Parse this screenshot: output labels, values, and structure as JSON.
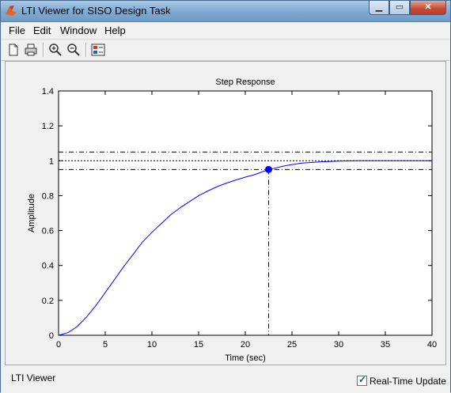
{
  "window": {
    "title": "LTI Viewer for SISO Design Task",
    "minimize": "▁",
    "maximize": "▭",
    "close": "✕"
  },
  "menu": [
    {
      "label": "File"
    },
    {
      "label": "Edit"
    },
    {
      "label": "Window"
    },
    {
      "label": "Help"
    }
  ],
  "toolbar": {
    "icons": [
      "new-document-icon",
      "print-icon",
      "zoom-in-icon",
      "zoom-out-icon",
      "plot-configuration-icon"
    ]
  },
  "status": {
    "label": "LTI Viewer"
  },
  "realtime": {
    "label": "Real-Time Update",
    "checked": true
  },
  "chart_data": {
    "type": "line",
    "title": "Step Response",
    "xlabel": "Time (sec)",
    "ylabel": "Amplitude",
    "xlim": [
      0,
      40
    ],
    "ylim": [
      0,
      1.4
    ],
    "xticks": [
      "0",
      "5",
      "10",
      "15",
      "20",
      "25",
      "30",
      "35",
      "40"
    ],
    "yticks": [
      "0",
      "0.2",
      "0.4",
      "0.6",
      "0.8",
      "1",
      "1.2",
      "1.4"
    ],
    "series": [
      {
        "x": [
          0,
          1,
          2,
          3,
          4,
          5,
          6,
          7,
          8,
          9,
          10,
          11,
          12,
          13,
          14,
          15,
          16,
          17,
          18,
          19,
          20,
          21,
          22,
          23,
          24,
          25,
          26,
          27,
          28,
          29,
          30,
          31,
          32,
          33,
          34,
          35,
          36,
          37,
          38,
          39,
          40
        ],
        "y": [
          0,
          0.015,
          0.05,
          0.105,
          0.17,
          0.245,
          0.32,
          0.395,
          0.465,
          0.535,
          0.59,
          0.64,
          0.69,
          0.73,
          0.765,
          0.8,
          0.827,
          0.852,
          0.872,
          0.89,
          0.906,
          0.92,
          0.94,
          0.955,
          0.968,
          0.978,
          0.986,
          0.99,
          0.993,
          0.996,
          0.998,
          0.999,
          1.0,
          1.0,
          1.0,
          1.0,
          1.0,
          1.0,
          1.0,
          1.0,
          1.0
        ],
        "color": "#0000ff"
      }
    ],
    "reference_lines": {
      "final_value": 1.0,
      "upper_band": 1.05,
      "lower_band": 0.95
    },
    "marker": {
      "x": 22.5,
      "y": 0.95,
      "color": "#0000ff"
    }
  }
}
